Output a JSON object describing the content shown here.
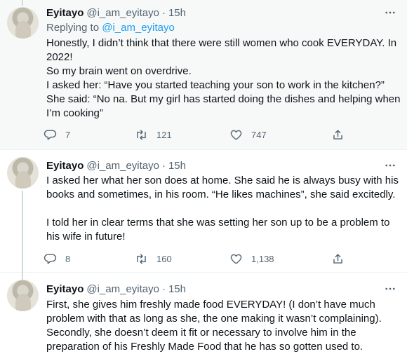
{
  "tweets": [
    {
      "name": "Eyitayo",
      "handle": "@i_am_eyitayo",
      "time": "15h",
      "replying_to_label": "Replying to",
      "replying_to_handle": "@i_am_eyitayo",
      "lines": [
        "Honestly, I didn’t think that there were still women who cook EVERYDAY. In 2022!",
        "So my brain went on overdrive.",
        "I asked her: “Have you started teaching your son to work in the kitchen?”",
        "She said: “No na. But my girl has started doing the dishes and helping when I’m cooking”"
      ],
      "replies": "7",
      "retweets": "121",
      "likes": "747"
    },
    {
      "name": "Eyitayo",
      "handle": "@i_am_eyitayo",
      "time": "15h",
      "lines": [
        "I asked her what her son does at home. She said he is always busy with his books and sometimes, in his room. “He likes machines”, she said excitedly.",
        "I told her in clear terms that she was setting her son up to be a problem to his wife in future!"
      ],
      "replies": "8",
      "retweets": "160",
      "likes": "1,138"
    },
    {
      "name": "Eyitayo",
      "handle": "@i_am_eyitayo",
      "time": "15h",
      "lines": [
        "First, she gives him freshly made food EVERYDAY! (I don’t have much problem with that as long as she, the one making it wasn’t complaining).",
        "Secondly, she doesn’t deem it fit or necessary to involve him in the preparation of his Freshly Made Food that he has so gotten used to."
      ]
    }
  ],
  "separator": "·",
  "icons": {
    "more": "more-horizontal-icon",
    "reply": "reply-bubble-icon",
    "retweet": "retweet-icon",
    "like": "heart-icon",
    "share": "share-icon"
  }
}
